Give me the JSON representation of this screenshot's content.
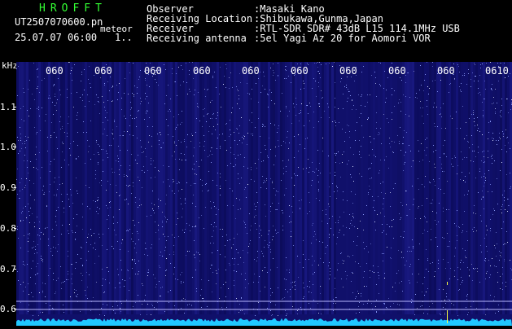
{
  "header": {
    "program": "HROFFT",
    "file_name": "UT2507070600.pn",
    "meteor_label": "meteor",
    "datetime": "25.07.07 06:00",
    "count": "1..",
    "info": [
      {
        "label": "Observer",
        "value": ":Masaki Kano"
      },
      {
        "label": "Receiving Location",
        "value": ":Shibukawa,Gunma,Japan"
      },
      {
        "label": "Receiver",
        "value": ":RTL-SDR SDR# 43dB L15 114.1MHz USB"
      },
      {
        "label": "Receiving antenna",
        "value": ":5el Yagi Az 20 for Aomori VOR"
      }
    ]
  },
  "axis": {
    "y_unit": "kHz",
    "y_ticks": [
      "1.1",
      "1.0",
      "0.9",
      "0.8",
      "0.7",
      "0.6"
    ],
    "x_ticks": [
      "060",
      "060",
      "060",
      "060",
      "060",
      "060",
      "060",
      "060",
      "060",
      "0610"
    ]
  },
  "colors": {
    "background": "#000000",
    "waterfall_base": "#10106a",
    "noise_speck": "#8fa0ff",
    "baseline_band": "#20c8ff",
    "reference_line": "#b8b8ff",
    "marker": "#ffff40",
    "program_title": "#33ff33"
  }
}
